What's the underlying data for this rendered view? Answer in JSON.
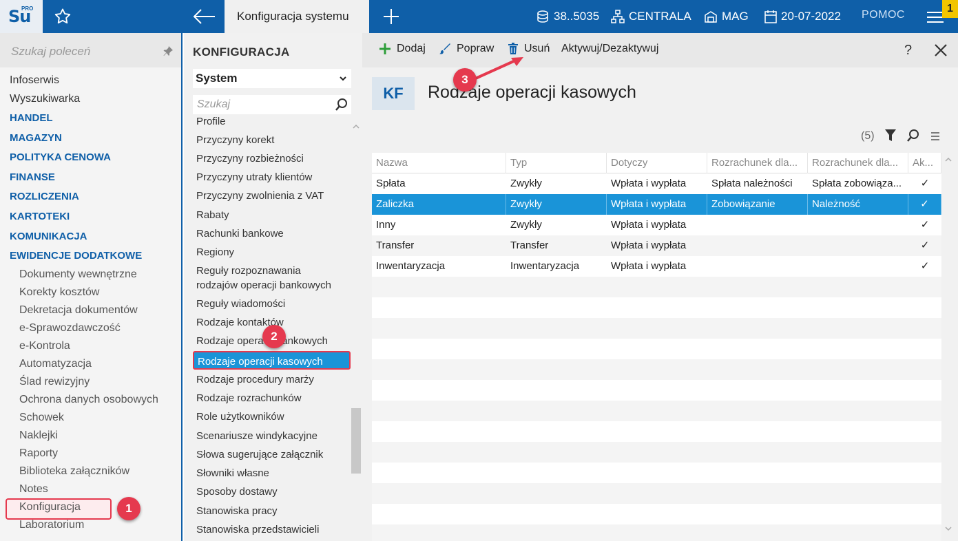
{
  "topbar": {
    "logo": "Su",
    "logo_sup": "PRO",
    "active_tab": "Konfiguracja systemu",
    "database": "38..5035",
    "branch": "CENTRALA",
    "warehouse": "MAG",
    "date": "20-07-2022",
    "help": "POMOC",
    "notifications": "1"
  },
  "left_nav": {
    "search_placeholder": "Szukaj poleceń",
    "items": [
      {
        "label": "Infoserwis",
        "kind": "plain"
      },
      {
        "label": "Wyszukiwarka",
        "kind": "plain"
      },
      {
        "label": "HANDEL",
        "kind": "section"
      },
      {
        "label": "MAGAZYN",
        "kind": "section"
      },
      {
        "label": "POLITYKA CENOWA",
        "kind": "section"
      },
      {
        "label": "FINANSE",
        "kind": "section"
      },
      {
        "label": "ROZLICZENIA",
        "kind": "section"
      },
      {
        "label": "KARTOTEKI",
        "kind": "section"
      },
      {
        "label": "KOMUNIKACJA",
        "kind": "section"
      },
      {
        "label": "EWIDENCJE DODATKOWE",
        "kind": "section"
      },
      {
        "label": "Dokumenty wewnętrzne",
        "kind": "sub"
      },
      {
        "label": "Korekty kosztów",
        "kind": "sub"
      },
      {
        "label": "Dekretacja dokumentów",
        "kind": "sub"
      },
      {
        "label": "e-Sprawozdawczość",
        "kind": "sub"
      },
      {
        "label": "e-Kontrola",
        "kind": "sub"
      },
      {
        "label": "Automatyzacja",
        "kind": "sub"
      },
      {
        "label": "Ślad rewizyjny",
        "kind": "sub"
      },
      {
        "label": "Ochrona danych osobowych",
        "kind": "sub"
      },
      {
        "label": "Schowek",
        "kind": "sub"
      },
      {
        "label": "Naklejki",
        "kind": "sub"
      },
      {
        "label": "Raporty",
        "kind": "sub"
      },
      {
        "label": "Biblioteka załączników",
        "kind": "sub"
      },
      {
        "label": "Notes",
        "kind": "sub"
      },
      {
        "label": "Konfiguracja",
        "kind": "sub"
      },
      {
        "label": "Laboratorium",
        "kind": "sub"
      }
    ]
  },
  "mid_panel": {
    "title": "KONFIGURACJA",
    "select_value": "System",
    "search_placeholder": "Szukaj",
    "items": [
      "Profile",
      "Przyczyny korekt",
      "Przyczyny rozbieżności",
      "Przyczyny utraty klientów",
      "Przyczyny zwolnienia z VAT",
      "Rabaty",
      "Rachunki bankowe",
      "Regiony",
      "Reguły rozpoznawania",
      "rodzajów operacji bankowych",
      "Reguły wiadomości",
      "Rodzaje kontaktów",
      "Rodzaje operacji bankowych",
      "Rodzaje operacji kasowych",
      "Rodzaje procedury marży",
      "Rodzaje rozrachunków",
      "Role użytkowników",
      "Scenariusze windykacyjne",
      "Słowa sugerujące załącznik",
      "Słowniki własne",
      "Sposoby dostawy",
      "Stanowiska pracy",
      "Stanowiska przedstawicieli"
    ]
  },
  "toolbar": {
    "add": "Dodaj",
    "edit": "Popraw",
    "delete": "Usuń",
    "toggle": "Aktywuj/Dezaktywuj",
    "help": "?"
  },
  "content": {
    "badge": "KF",
    "title": "Rodzaje operacji kasowych",
    "count": "(5)"
  },
  "grid": {
    "columns": [
      "Nazwa",
      "Typ",
      "Dotyczy",
      "Rozrachunek dla...",
      "Rozrachunek dla...",
      "Ak..."
    ],
    "rows": [
      [
        "Spłata",
        "Zwykły",
        "Wpłata i wypłata",
        "Spłata należności",
        "Spłata zobowiąza...",
        "✓"
      ],
      [
        "Zaliczka",
        "Zwykły",
        "Wpłata i wypłata",
        "Zobowiązanie",
        "Należność",
        "✓"
      ],
      [
        "Inny",
        "Zwykły",
        "Wpłata i wypłata",
        "",
        "",
        "✓"
      ],
      [
        "Transfer",
        "Transfer",
        "Wpłata i wypłata",
        "",
        "",
        "✓"
      ],
      [
        "Inwentaryzacja",
        "Inwentaryzacja",
        "Wpłata i wypłata",
        "",
        "",
        "✓"
      ]
    ],
    "selected_row": 1
  },
  "annotations": [
    "1",
    "2",
    "3"
  ],
  "colors": {
    "brand": "#0f5fa8",
    "selection": "#1a94d8",
    "annotation": "#e5394e",
    "badge": "#f2c500"
  }
}
